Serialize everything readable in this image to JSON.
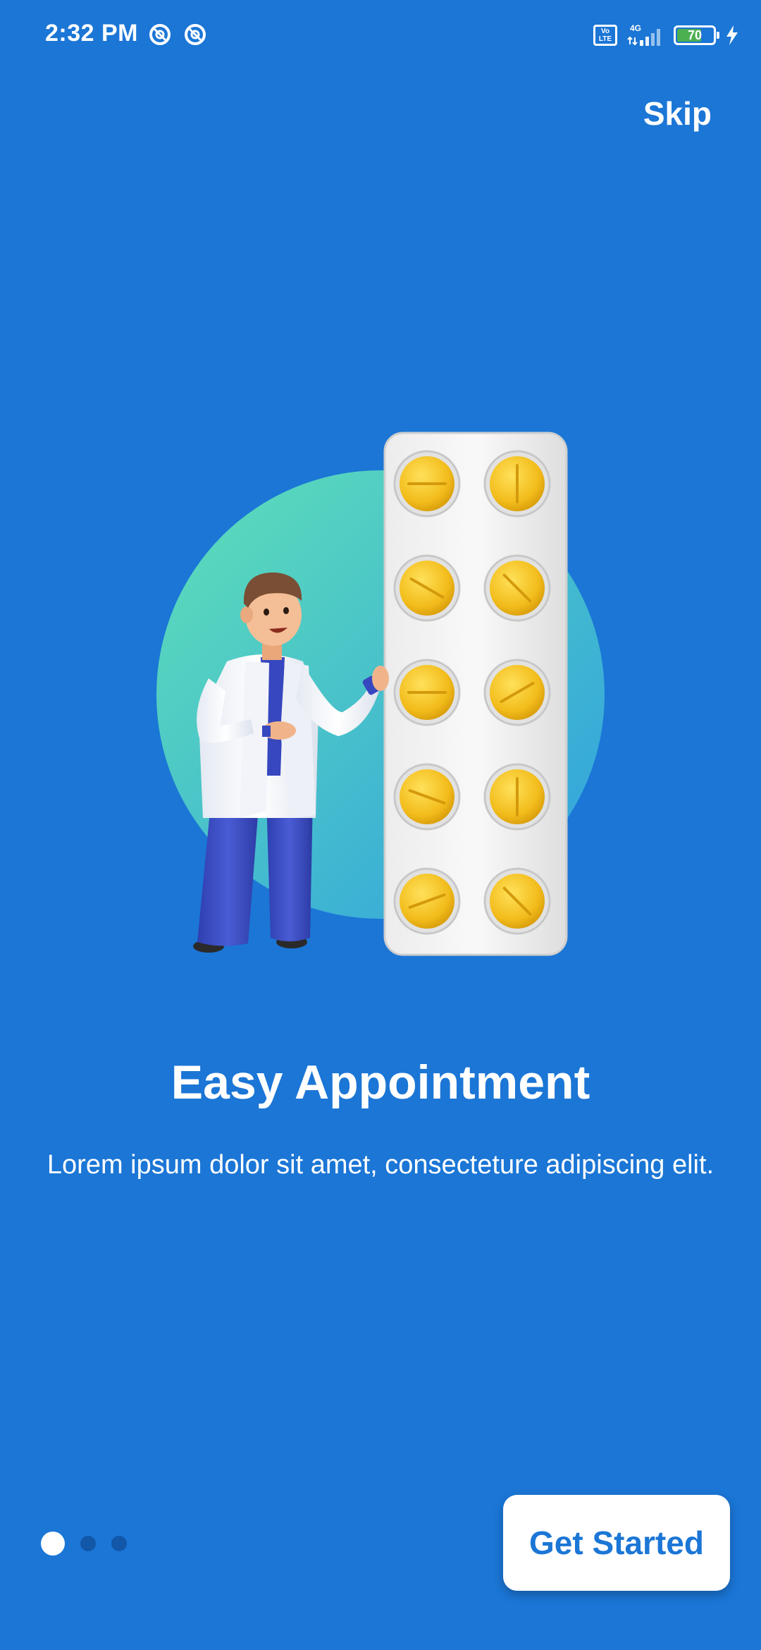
{
  "status_bar": {
    "time": "2:32 PM",
    "left_icons": [
      "sync-icon",
      "sync-icon"
    ],
    "volte_label": "Vo LTE",
    "network_label": "4G",
    "battery_level": "70",
    "battery_fraction": 0.7,
    "charging": true
  },
  "onboarding": {
    "skip_label": "Skip",
    "title": "Easy Appointment",
    "description": "Lorem ipsum dolor sit amet, consecteture adipiscing elit.",
    "page_count": 3,
    "current_page": 1,
    "cta_label": "Get Started"
  },
  "colors": {
    "background": "#1B76D6",
    "circle_gradient_start": "#5FE0B7",
    "circle_gradient_end": "#2F9FE0",
    "pill": "#F4C21E",
    "button_text": "#1B76D6"
  },
  "illustration": {
    "icon": "doctor-with-pill-blister-icon"
  }
}
